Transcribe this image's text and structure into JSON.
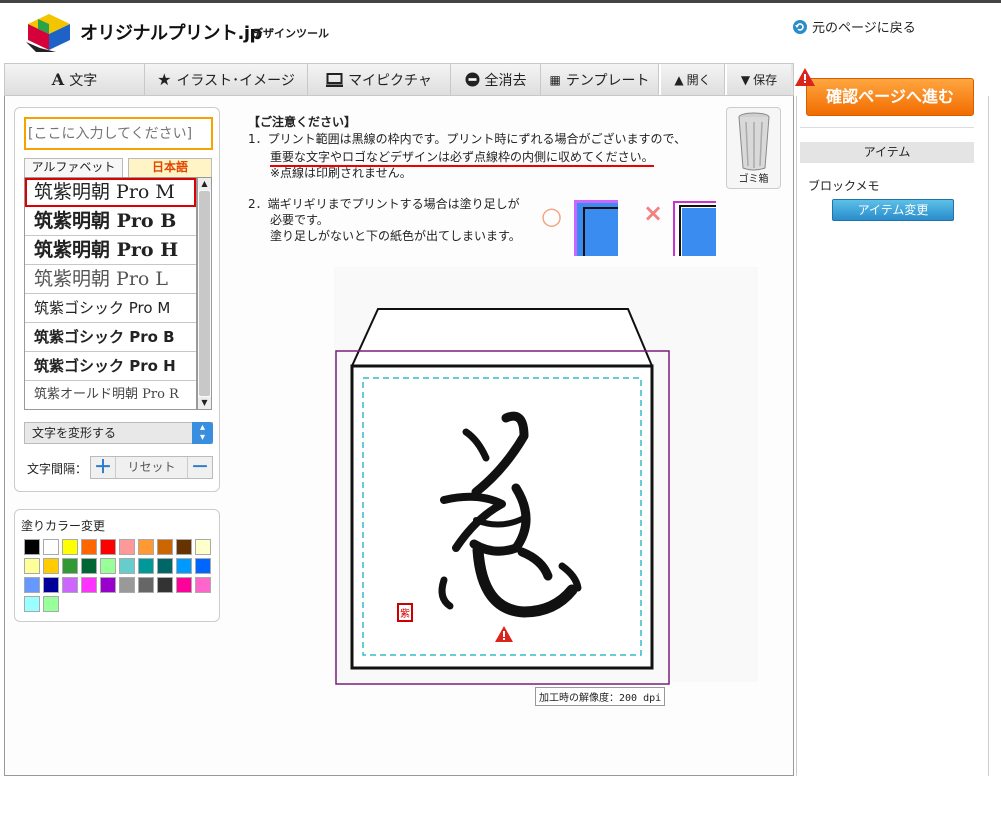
{
  "header": {
    "brand": "オリジナルプリント.jp",
    "subtitle": "デザインツール",
    "back_link": "元のページに戻る"
  },
  "toolbar": {
    "text": "文字",
    "illust": "イラスト･イメージ",
    "mypicture": "マイピクチャ",
    "clear_all": "全消去",
    "template": "テンプレート",
    "open": "開く",
    "save": "保存"
  },
  "text_panel": {
    "input_placeholder": "[ここに入力してください]",
    "tab_alphabet": "アルファベット",
    "tab_japanese": "日本語",
    "fonts": [
      "筑紫明朝 Pro M",
      "筑紫明朝 Pro B",
      "筑紫明朝 Pro H",
      "筑紫明朝 Pro L",
      "筑紫ゴシック Pro M",
      "筑紫ゴシック Pro B",
      "筑紫ゴシック Pro H",
      "筑紫オールド明朝 Pro R"
    ],
    "transform_label": "文字を変形する",
    "spacing_label": "文字間隔：",
    "spacing_reset": "リセット"
  },
  "color_panel": {
    "label": "塗りカラー変更",
    "swatches": [
      "#000000",
      "#ffffff",
      "#ffff00",
      "#ff6600",
      "#ff0000",
      "#ff9999",
      "#ff9933",
      "#cc6600",
      "#663300",
      "#ffffcc",
      "#ffff99",
      "#ffcc00",
      "#339933",
      "#006633",
      "#99ff99",
      "#66cccc",
      "#009999",
      "#006666",
      "#0099ff",
      "#0066ff",
      "#6699ff",
      "#000099",
      "#cc66ff",
      "#ff33ff",
      "#9900cc",
      "#999999",
      "#666666",
      "#333333",
      "#ff0099",
      "#ff66cc",
      "#99ffff",
      "#99ff99"
    ]
  },
  "notice": {
    "title": "【ご注意ください】",
    "item1_line1": "1．プリント範囲は黒線の枠内です。プリント時にずれる場合がございますので、",
    "item1_line2": "重要な文字やロゴなどデザインは必ず点線枠の内側に収めてください。",
    "item1_line3": "※点線は印刷されません。",
    "item2_line1": "2．端ギリギリまでプリントする場合は塗り足しが",
    "item2_line2": "必要です。",
    "item2_line3": "塗り足しがないと下の紙色が出てしまいます。",
    "ok_mark": "○",
    "ng_mark": "×",
    "trash_label": "ゴミ箱"
  },
  "canvas": {
    "seal_text": "紫",
    "dpi_label": "加工時の解像度：200 dpi"
  },
  "side": {
    "confirm_button": "確認ページへ進む",
    "item_heading": "アイテム",
    "item_name": "ブロックメモ",
    "item_change_button": "アイテム変更"
  },
  "colors": {
    "accent_orange": "#f26c00",
    "bleed_line": "#7a1f7a",
    "safe_line": "#33bbcc",
    "item_button": "#2a8ccb"
  }
}
